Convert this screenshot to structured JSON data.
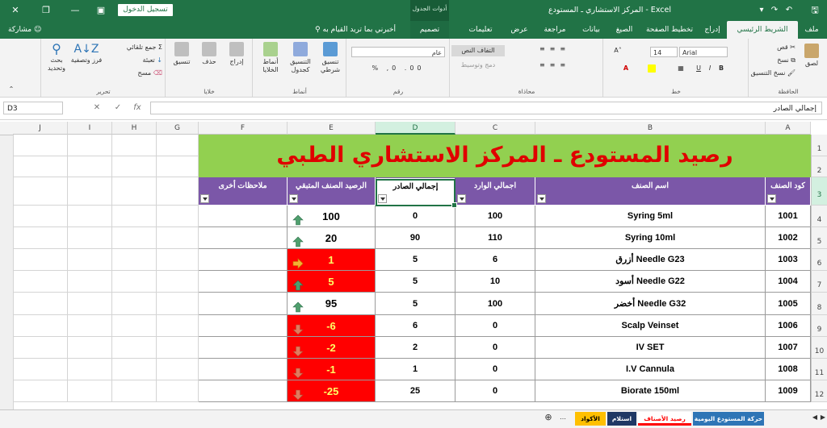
{
  "window": {
    "title": "المركز الاستشاري ـ المستودع  -  Excel",
    "table_tools": "أدوات الجدول",
    "signin_label": "تسجيل الدخول"
  },
  "tabs": {
    "file": "ملف",
    "home": "الشريط الرئيسي",
    "insert": "إدراج",
    "page_layout": "تخطيط الصفحة",
    "formulas": "الصيغ",
    "data": "بيانات",
    "review": "مراجعة",
    "view": "عرض",
    "help": "تعليمات",
    "design": "تصميم",
    "tell_me": "أخبرني بما تريد القيام به",
    "share": "مشاركة"
  },
  "ribbon": {
    "clipboard": {
      "label": "الحافظة",
      "paste": "لصق",
      "cut": "قص",
      "copy": "نسخ",
      "format_painter": "نسخ التنسيق"
    },
    "font": {
      "label": "خط",
      "name": "Arial",
      "size": "14"
    },
    "alignment": {
      "label": "محاذاة",
      "wrap": "التفاف النص",
      "merge": "دمج وتوسيط"
    },
    "number": {
      "label": "رقم",
      "format": "عام"
    },
    "styles": {
      "label": "أنماط",
      "conditional": "تنسيق شرطي",
      "as_table": "التنسيق كجدول",
      "cell_styles": "أنماط الخلايا"
    },
    "cells": {
      "label": "خلايا",
      "insert": "إدراج",
      "delete": "حذف",
      "format": "تنسيق"
    },
    "editing": {
      "label": "تحرير",
      "autosum": "جمع تلقائي",
      "fill": "تعبئة",
      "clear": "مسح",
      "sort": "فرز وتصفية",
      "find": "بحث وتحديد"
    }
  },
  "formula_bar": {
    "name_box": "D3",
    "formula": "إجمالي الصادر",
    "fx": "fx"
  },
  "columns": [
    "A",
    "B",
    "C",
    "D",
    "E",
    "F",
    "G",
    "H",
    "I",
    "J"
  ],
  "rows": [
    "1",
    "2",
    "3",
    "4",
    "5",
    "6",
    "7",
    "8",
    "9",
    "10",
    "11",
    "12"
  ],
  "sheet": {
    "title": "رصيد المستودع ـ المركز الاستشاري الطبي",
    "headers": {
      "code": "كود الصنف",
      "name": "اسم الصنف",
      "received": "اجمالي الوارد",
      "issued": "إجمالي الصادر",
      "balance": "الرصيد الصنف المتبقي",
      "notes": "ملاحظات أخرى"
    },
    "items": [
      {
        "code": "1001",
        "name": "Syring 5ml",
        "received": "100",
        "issued": "0",
        "balance": "100",
        "trend": "up",
        "low": false
      },
      {
        "code": "1002",
        "name": "Syring 10ml",
        "received": "110",
        "issued": "90",
        "balance": "20",
        "trend": "up",
        "low": false
      },
      {
        "code": "1003",
        "name": "Needle G23 أزرق",
        "received": "6",
        "issued": "5",
        "balance": "1",
        "trend": "side",
        "low": true
      },
      {
        "code": "1004",
        "name": "Needle G22 أسود",
        "received": "10",
        "issued": "5",
        "balance": "5",
        "trend": "up",
        "low": true
      },
      {
        "code": "1005",
        "name": "Needle G32 أخضر",
        "received": "100",
        "issued": "5",
        "balance": "95",
        "trend": "up",
        "low": false
      },
      {
        "code": "1006",
        "name": "Scalp Veinset",
        "received": "0",
        "issued": "6",
        "balance": "-6",
        "trend": "down",
        "low": true
      },
      {
        "code": "1007",
        "name": "IV SET",
        "received": "0",
        "issued": "2",
        "balance": "-2",
        "trend": "down",
        "low": true
      },
      {
        "code": "1008",
        "name": "I.V Cannula",
        "received": "0",
        "issued": "1",
        "balance": "-1",
        "trend": "down",
        "low": true
      },
      {
        "code": "1009",
        "name": "Biorate 150ml",
        "received": "0",
        "issued": "25",
        "balance": "-25",
        "trend": "down",
        "low": true
      }
    ]
  },
  "sheet_tabs": [
    {
      "label": "حركة المستودع اليومية",
      "color": "#2e75b6",
      "text": "#ffffff"
    },
    {
      "label": "رصيد الأصناف",
      "color": "#ff0000",
      "text": "#ffffff"
    },
    {
      "label": "استلام",
      "color": "#1f3864",
      "text": "#ffffff"
    },
    {
      "label": "الأكواد",
      "color": "#ffc000",
      "text": "#000000"
    }
  ],
  "colors": {
    "excel_green": "#217346",
    "header_purple": "#7b57a8",
    "title_green": "#92d050",
    "title_red": "#e00000",
    "low_red": "#ff0000"
  }
}
